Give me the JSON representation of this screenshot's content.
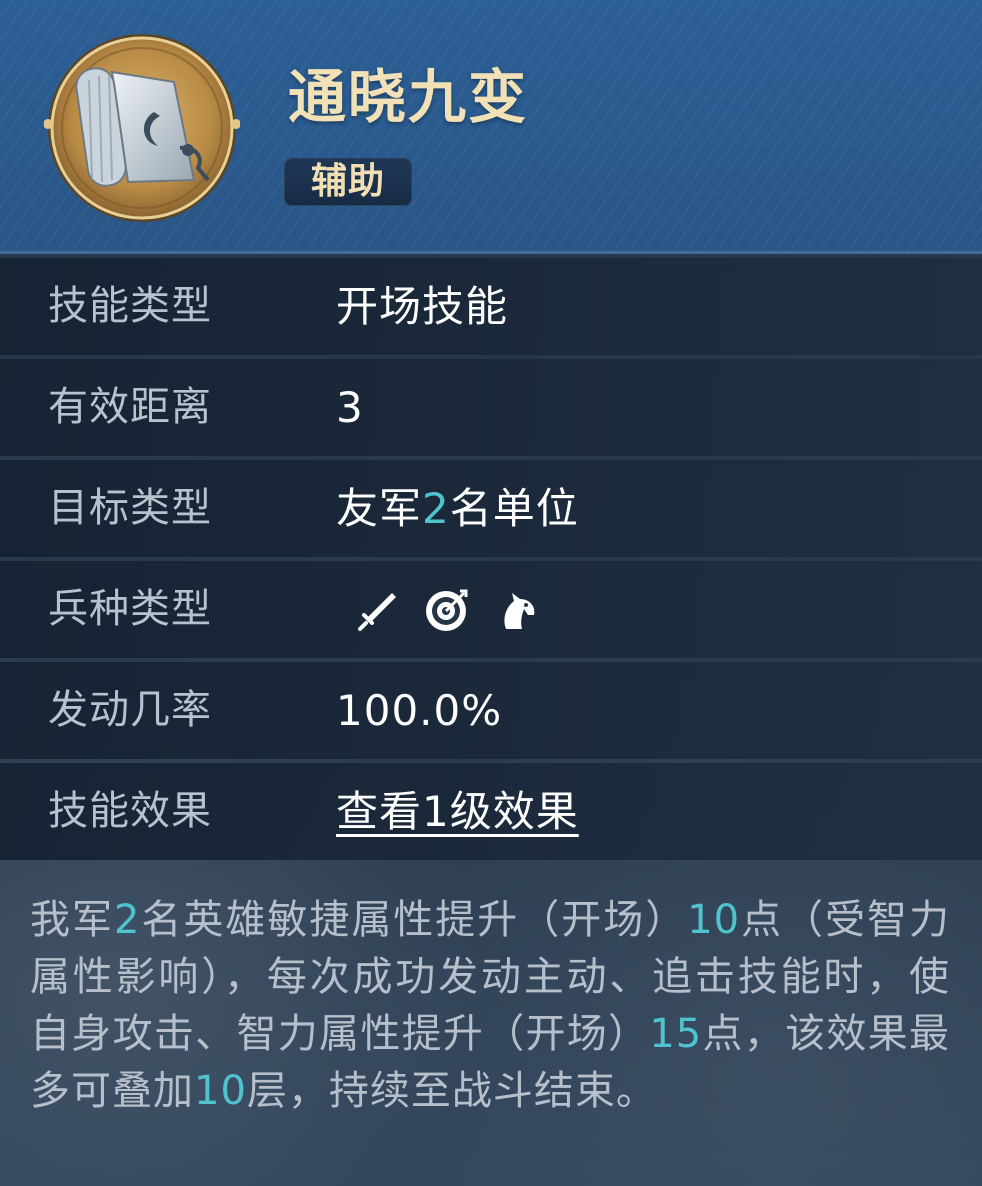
{
  "skill": {
    "title": "通晓九变",
    "role": "辅助",
    "icon": "scroll-icon"
  },
  "rows": [
    {
      "label": "技能类型",
      "value": "开场技能"
    },
    {
      "label": "有效距离",
      "value": "3"
    },
    {
      "label": "目标类型",
      "value_parts": [
        "友军",
        "2",
        "名单位"
      ]
    },
    {
      "label": "兵种类型",
      "troops": [
        "sword-icon",
        "target-icon",
        "horse-icon"
      ]
    },
    {
      "label": "发动几率",
      "value": "100.0%"
    },
    {
      "label": "技能效果",
      "link": "查看1级效果"
    }
  ],
  "description": [
    {
      "t": "我军",
      "hl": false
    },
    {
      "t": "2",
      "hl": true
    },
    {
      "t": "名英雄敏捷属性提升（开场）",
      "hl": false
    },
    {
      "t": "10",
      "hl": true
    },
    {
      "t": "点（受智力属性影响），每次成功发动主动、追击技能时，使自身攻击、智力属性提升（开场）",
      "hl": false
    },
    {
      "t": "15",
      "hl": true
    },
    {
      "t": "点，该效果最多可叠加",
      "hl": false
    },
    {
      "t": "10",
      "hl": true
    },
    {
      "t": "层，持续至战斗结束。",
      "hl": false
    }
  ],
  "colors": {
    "accent": "#4fc4cf",
    "title": "#f2e1b6",
    "label": "#b8c1cc",
    "header": "#2c5f95"
  }
}
